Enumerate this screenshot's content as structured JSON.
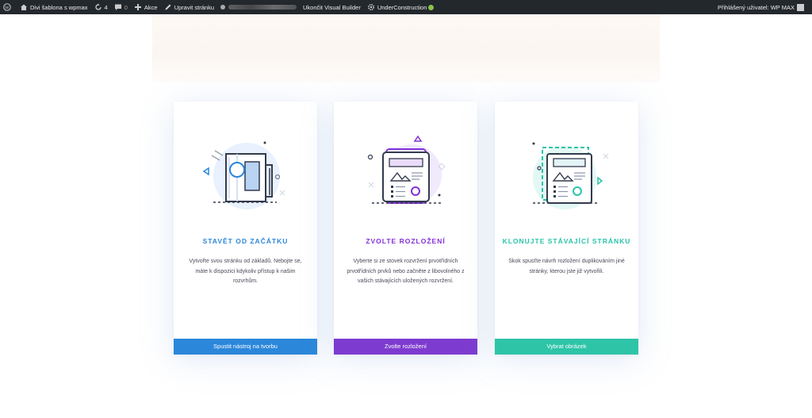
{
  "adminbar": {
    "site_name": "Divi šablona s wpmax",
    "updates_count": "4",
    "comments_count": "0",
    "new_label": "Akce",
    "edit_label": "Upravit stránku",
    "exit_builder_label": "Ukončit Visual Builder",
    "under_construction_label": "UnderConstruction",
    "user_greeting": "Přihlášený uživatel: WP MAX"
  },
  "cards": [
    {
      "title": "STAVĚT OD ZAČÁTKU",
      "description": "Vytvořte svou stránku od základů. Nebojte se, máte k dispozici kdykoliv přístup k našim rozvrhům.",
      "button": "Spustit nástroj na tvorbu",
      "accent": "#2b87da"
    },
    {
      "title": "ZVOLTE ROZLOŽENÍ",
      "description": "Vyberte si ze stovek rozvržení prvotřídních prvotřídních prvků nebo začněte z libovolného z vašich stávajících uložených rozvržení.",
      "button": "Zvolte rozložení",
      "accent": "#7e3bd0"
    },
    {
      "title": "KLONUJTE STÁVAJÍCÍ STRÁNKU",
      "description": "Skok spusťte návrh rozložení duplikováním jiné stránky, kterou jste již vytvořili.",
      "button": "Vybrat obrázek",
      "accent": "#2ec4a8"
    }
  ]
}
